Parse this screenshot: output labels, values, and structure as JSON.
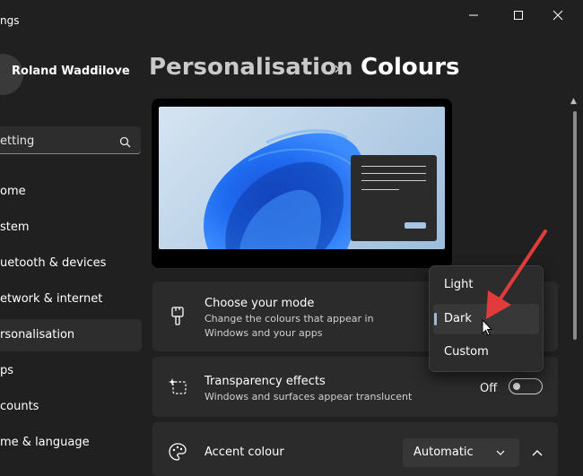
{
  "window": {
    "title": "ngs"
  },
  "account": {
    "name": "Roland Waddilove"
  },
  "search": {
    "value": "etting"
  },
  "sidebar": {
    "items": [
      {
        "label": "ome"
      },
      {
        "label": "stem"
      },
      {
        "label": "uetooth & devices"
      },
      {
        "label": "etwork & internet"
      },
      {
        "label": "rsonalisation",
        "active": true
      },
      {
        "label": "ps"
      },
      {
        "label": "counts"
      },
      {
        "label": "me & language"
      }
    ]
  },
  "breadcrumb": {
    "parent": "Personalisation",
    "separator": "›",
    "current": "Colours"
  },
  "settings": {
    "mode": {
      "title": "Choose your mode",
      "subtitle_line1": "Change the colours that appear in",
      "subtitle_line2": "Windows and your apps"
    },
    "transparency": {
      "title": "Transparency effects",
      "subtitle": "Windows and surfaces appear translucent",
      "state": "Off"
    },
    "accent": {
      "title": "Accent colour",
      "value": "Automatic"
    }
  },
  "mode_menu": {
    "options": [
      {
        "label": "Light"
      },
      {
        "label": "Dark",
        "selected": true
      },
      {
        "label": "Custom"
      }
    ]
  },
  "colors": {
    "background": "#202020",
    "card": "#2b2b2b",
    "accent": "#9fb8e0",
    "annotation_arrow": "#e23b3b"
  },
  "icons": [
    "minimize-icon",
    "maximize-icon",
    "close-icon",
    "search-icon",
    "brush-icon",
    "transparency-icon",
    "palette-icon",
    "chevron-down-icon",
    "chevron-up-icon",
    "cursor-icon",
    "arrow-annotation-icon"
  ]
}
